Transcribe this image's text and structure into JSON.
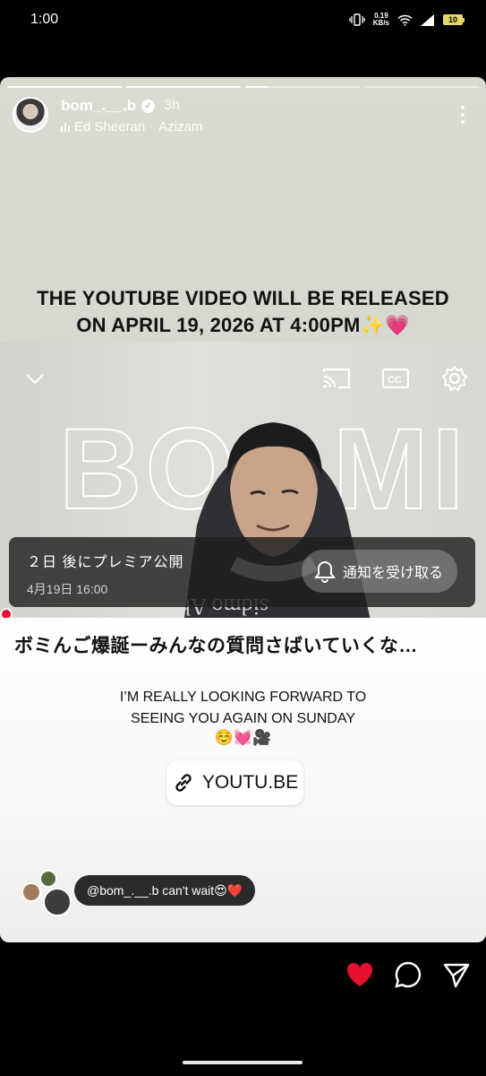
{
  "status_bar": {
    "time": "1:00",
    "net_speed_value": "0.19",
    "net_speed_unit": "KB/s",
    "battery": "10"
  },
  "story": {
    "progress": [
      1.0,
      1.0,
      0.2,
      0.0
    ],
    "username": "bom_.__.b",
    "time_ago": "3h",
    "music_artist": "Ed Sheeran",
    "music_sep": "·",
    "music_song": "Azizam",
    "headline_line1": "THE YOUTUBE VIDEO WILL BE RELEASED",
    "headline_line2": "ON APRIL 19, 2026 AT 4:00PM✨💗",
    "video": {
      "big_text_left": "BO",
      "big_text_right": "MI",
      "shirt_text": "sidmo Ab",
      "premiere_title": "２日 後にプレミア公開",
      "premiere_date": "4月19日 16:00",
      "notify_label": "通知を受け取る"
    },
    "jp_title": "ボミんご爆誕ーみんなの質問さばいていくな…",
    "message_line1": "I’M REALLY LOOKING FORWARD TO",
    "message_line2": "SEEING YOU AGAIN ON SUNDAY",
    "message_emojis": "☺️💓🎥",
    "link_label": "YOUTU.BE",
    "mention_text": "@bom_.__.b can't wait😍❤️"
  },
  "colors": {
    "background": "#000000",
    "heart": "#e5112e",
    "battery": "#e6d76a"
  }
}
